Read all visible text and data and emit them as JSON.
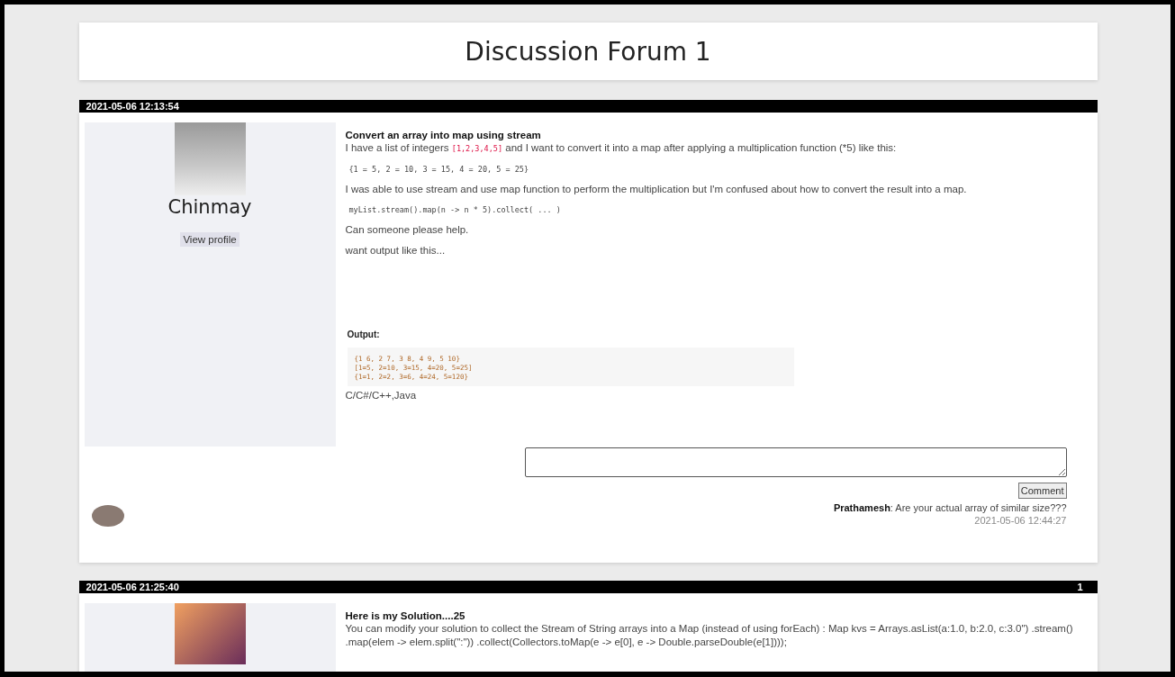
{
  "page_title": "Discussion Forum 1",
  "posts": [
    {
      "timestamp": "2021-05-06 12:13:54",
      "author": {
        "name": "Chinmay",
        "profile_button": "View profile"
      },
      "title": "Convert an array into map using stream",
      "body": [
        {
          "kind": "text",
          "parts": [
            {
              "kind": "text",
              "text": "I have a list of integers "
            },
            {
              "kind": "code",
              "text": "[1,2,3,4,5]"
            },
            {
              "kind": "text",
              "text": " and I want to convert it into a map after applying a multiplication function (*5) like this:"
            }
          ]
        },
        {
          "kind": "code",
          "lines": [
            "{1 = 5, 2 = 10, 3 = 15, 4 = 20, 5 = 25}"
          ]
        },
        {
          "kind": "text",
          "parts": [
            {
              "kind": "text",
              "text": "I was able to use stream and use map function to perform the multiplication but I'm confused about how to convert the result into a map."
            }
          ]
        },
        {
          "kind": "code",
          "lines": [
            "myList.stream().map(n -> n * 5).collect( ... )"
          ]
        },
        {
          "kind": "text",
          "parts": [
            {
              "kind": "text",
              "text": "Can someone please help."
            }
          ]
        },
        {
          "kind": "text",
          "parts": [
            {
              "kind": "text",
              "text": "want output like this..."
            }
          ]
        },
        {
          "kind": "heading",
          "text": "Output:"
        },
        {
          "kind": "output",
          "lines": [
            "{1 6, 2 7, 3 8, 4 9, 5 10}",
            "[1=5, 2=10, 3=15, 4=20, 5=25]",
            "{1=1, 2=2, 3=6, 4=24, 5=120}"
          ]
        },
        {
          "kind": "tags",
          "text": "C/C#/C++,Java"
        }
      ],
      "comment_button": "Comment",
      "comments": [
        {
          "author": "Prathamesh",
          "text": ": Are your actual array of similar size???",
          "time": "2021-05-06 12:44:27"
        }
      ]
    },
    {
      "timestamp": "2021-05-06 21:25:40",
      "count": "1",
      "title": "Here is my Solution....25",
      "body": [
        {
          "kind": "text",
          "parts": [
            {
              "kind": "text",
              "text": "You can modify your solution to collect the Stream of String arrays into a Map (instead of using forEach) : Map kvs = Arrays.asList(a:1.0, b:2.0, c:3.0\") .stream() .map(elem -> elem.split(\":\")) .collect(Collectors.toMap(e -> e[0], e -> Double.parseDouble(e[1])));"
            }
          ]
        }
      ]
    }
  ]
}
